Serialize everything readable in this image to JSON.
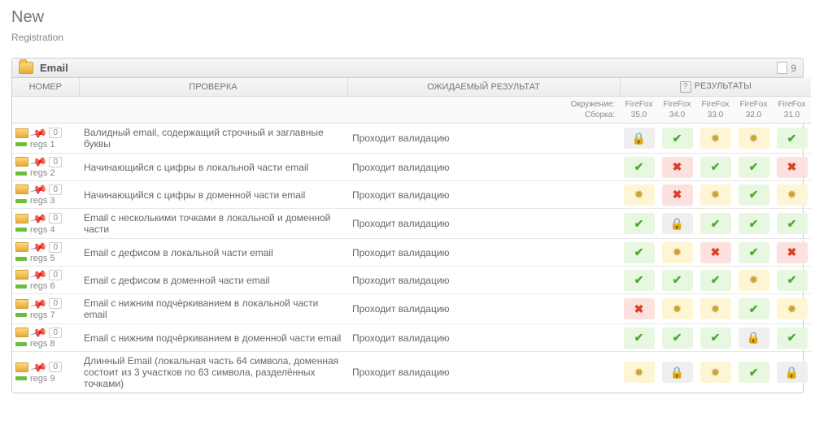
{
  "title": "New",
  "breadcrumb": "Registration",
  "panel": {
    "title": "Email",
    "count": "9"
  },
  "headers": {
    "num": "НОМЕР",
    "check": "ПРОВЕРКА",
    "expected": "ОЖИДАЕМЫЙ РЕЗУЛЬТАТ",
    "results": "РЕЗУЛЬТАТЫ"
  },
  "subheader": {
    "env_label": "Окружение:",
    "build_label": "Сборка:",
    "cols": [
      {
        "env": "FireFox",
        "build": "35.0"
      },
      {
        "env": "FireFox",
        "build": "34.0"
      },
      {
        "env": "FireFox",
        "build": "33.0"
      },
      {
        "env": "FireFox",
        "build": "32.0"
      },
      {
        "env": "FireFox",
        "build": "31.0"
      }
    ]
  },
  "rows": [
    {
      "pins": "0",
      "id": "regs 1",
      "check": "Валидный email, содержащий строчный и заглавные буквы",
      "expected": "Проходит валидацию",
      "res": [
        "lock",
        "tick",
        "bug",
        "bug",
        "tick"
      ]
    },
    {
      "pins": "0",
      "id": "regs 2",
      "check": "Начинающийся с цифры в локальной части email",
      "expected": "Проходит валидацию",
      "res": [
        "tick",
        "cross",
        "tick",
        "tick",
        "cross"
      ]
    },
    {
      "pins": "0",
      "id": "regs 3",
      "check": "Начинающийся с цифры в доменной части email",
      "expected": "Проходит валидацию",
      "res": [
        "bug",
        "cross",
        "bug",
        "tick",
        "bug"
      ]
    },
    {
      "pins": "0",
      "id": "regs 4",
      "check": "Email с несколькими точками в локальной и доменной части",
      "expected": "Проходит валидацию",
      "res": [
        "tick",
        "lock",
        "tick",
        "tick",
        "tick"
      ]
    },
    {
      "pins": "0",
      "id": "regs 5",
      "check": "Email с дефисом в локальной части email",
      "expected": "Проходит валидацию",
      "res": [
        "tick",
        "bug",
        "cross",
        "tick",
        "cross"
      ]
    },
    {
      "pins": "0",
      "id": "regs 6",
      "check": "Email с дефисом в доменной части email",
      "expected": "Проходит валидацию",
      "res": [
        "tick",
        "tick",
        "tick",
        "bug",
        "tick"
      ]
    },
    {
      "pins": "0",
      "id": "regs 7",
      "check": "Email с нижним подчёркиванием в локальной части email",
      "expected": "Проходит валидацию",
      "res": [
        "cross",
        "bug",
        "bug",
        "tick",
        "bug"
      ]
    },
    {
      "pins": "0",
      "id": "regs 8",
      "check": "Email с нижним подчёркиванием в доменной части email",
      "expected": "Проходит валидацию",
      "res": [
        "tick",
        "tick",
        "tick",
        "lock",
        "tick"
      ]
    },
    {
      "pins": "0",
      "id": "regs 9",
      "check": "Длинный Email (локальная часть 64 символа, доменная состоит из 3 участков по 63 символа, разделённых точками)",
      "expected": "Проходит валидацию",
      "res": [
        "bug",
        "lock",
        "bug",
        "tick",
        "lock"
      ]
    }
  ],
  "status_style": {
    "tick": "g",
    "cross": "r",
    "bug": "y",
    "lock": "s"
  }
}
